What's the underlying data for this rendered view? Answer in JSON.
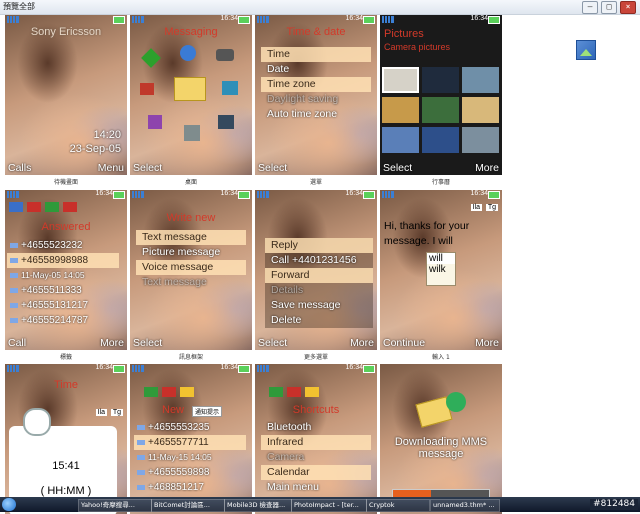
{
  "window": {
    "title": "預覽全部",
    "buttons": [
      "–",
      "□",
      "×"
    ]
  },
  "screens": [
    {
      "caption": "待機畫面",
      "clock": "",
      "title": "Sony Ericsson",
      "soft_left": "Calls",
      "soft_right": "Menu",
      "extra": {
        "time": "14:20",
        "date": "23-Sep-05"
      }
    },
    {
      "caption": "桌面",
      "clock": "16:34",
      "title": "Messaging",
      "soft_left": "Select",
      "soft_right": ""
    },
    {
      "caption": "選單",
      "clock": "16:34",
      "title": "Time & date",
      "soft_left": "Select",
      "soft_right": "",
      "items": [
        "Time",
        "Date",
        "Time zone",
        "Daylight saving",
        "Auto time zone"
      ],
      "hl": [
        0,
        2
      ],
      "dim": [
        3
      ]
    },
    {
      "caption": "行事曆",
      "clock": "16:34",
      "title": "Pictures",
      "soft_left": "Select",
      "soft_right": "More",
      "subtitle": "Camera pictures"
    },
    {
      "caption": "標籤",
      "clock": "16:34",
      "title": "Answered",
      "soft_left": "Call",
      "soft_right": "More",
      "rows": [
        "+4655523232",
        "+46558998988",
        "11-May-05      14:05",
        "+4655511333",
        "+46555131217",
        "+46555214787"
      ],
      "hl": [
        1
      ]
    },
    {
      "caption": "訊息框架",
      "clock": "16:34",
      "title": "Write new",
      "soft_left": "Select",
      "soft_right": "",
      "items": [
        "Text message",
        "Picture message",
        "Voice message",
        "Text message"
      ],
      "hl": [
        0,
        2
      ],
      "dim": [
        3
      ]
    },
    {
      "caption": "更多選單",
      "clock": "16:34",
      "title": "",
      "soft_left": "Select",
      "soft_right": "More",
      "items": [
        "Reply",
        "Call +4401231456",
        "Forward",
        "Details",
        "Save message",
        "Delete"
      ],
      "hl": [
        0,
        2
      ],
      "dim": [
        3
      ]
    },
    {
      "caption": "輸入 1",
      "clock": "16:34",
      "title": "",
      "soft_left": "Continue",
      "soft_right": "More",
      "text_lines": [
        "Hi, thanks for your",
        "message. I will"
      ],
      "suggestions": [
        "will",
        "wilk"
      ],
      "mode": "Ila",
      "case": "Tg"
    },
    {
      "caption": "",
      "clock": "16:34",
      "title": "Time",
      "soft_left": "",
      "soft_right": "",
      "extra": {
        "time": "15:41",
        "format": "( HH:MM )",
        "mode": "Ila",
        "case": "Tg"
      }
    },
    {
      "caption": "",
      "clock": "16:34",
      "title": "New",
      "soft_left": "",
      "soft_right": "",
      "tooltip": "通知提示",
      "rows": [
        "+4655553235",
        "+4655577711",
        "11-May-15      14:05",
        "+4655559898",
        "+468851217"
      ],
      "hl": [
        1
      ]
    },
    {
      "caption": "",
      "clock": "16:34",
      "title": "Shortcuts",
      "soft_left": "",
      "soft_right": "",
      "items": [
        "Bluetooth",
        "Infrared",
        "Camera",
        "Calendar",
        "Main menu"
      ],
      "hl": [
        1,
        3
      ],
      "dim": [
        2
      ]
    },
    {
      "caption": "",
      "clock": "",
      "title": "Downloading MMS message",
      "soft_left": "",
      "soft_right": ""
    }
  ],
  "taskbar": {
    "items": [
      "Yahoo!奇摩搜尋...",
      "BitComet討論區...",
      "Mobile3D 檢查器...",
      "PhotoImpact - [ter...",
      "Cryptok",
      "unnamed3.thm* ..."
    ],
    "tray_text": "#812484"
  },
  "colors": {
    "title_red": "#d23a2a",
    "highlight": "#ffe1b4",
    "taskbar": "#10182a"
  }
}
